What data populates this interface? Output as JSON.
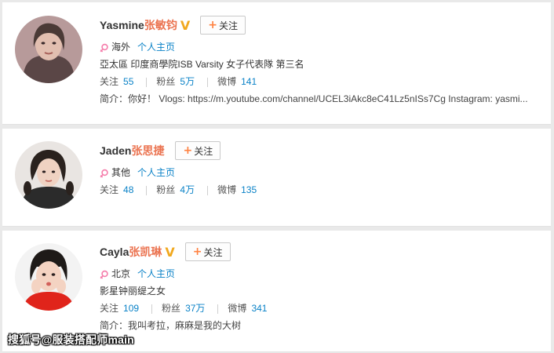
{
  "labels": {
    "follow": "关注",
    "home": "个人主页",
    "following": "关注",
    "fans": "粉丝",
    "weibo": "微博"
  },
  "users": [
    {
      "name_en": "Yasmine",
      "name_cn": "张敏钧",
      "verified": true,
      "location": "海外",
      "bio": "亞太區 印度商學院ISB Varsity 女子代表隊 第三名",
      "following": "55",
      "fans": "5万",
      "weibo": "141",
      "intro": "简介：你好！ Vlogs: https://m.youtube.com/channel/UCEL3iAkc8eC41Lz5nISs7Cg Instagram: yasmi..."
    },
    {
      "name_en": "Jaden",
      "name_cn": "张思捷",
      "verified": false,
      "location": "其他",
      "following": "48",
      "fans": "4万",
      "weibo": "135"
    },
    {
      "name_en": "Cayla",
      "name_cn": "张凯琳",
      "verified": true,
      "location": "北京",
      "bio": "影星钟丽缇之女",
      "following": "109",
      "fans": "37万",
      "weibo": "341",
      "intro": "简介：我叫考拉，麻麻是我的大树"
    }
  ],
  "watermark": "搜狐号@服装搭配师main",
  "colors": {
    "name_highlight": "#eb7350",
    "link": "#0a82c7",
    "verified": "#f1a81e",
    "female_icon": "#f57dab"
  }
}
